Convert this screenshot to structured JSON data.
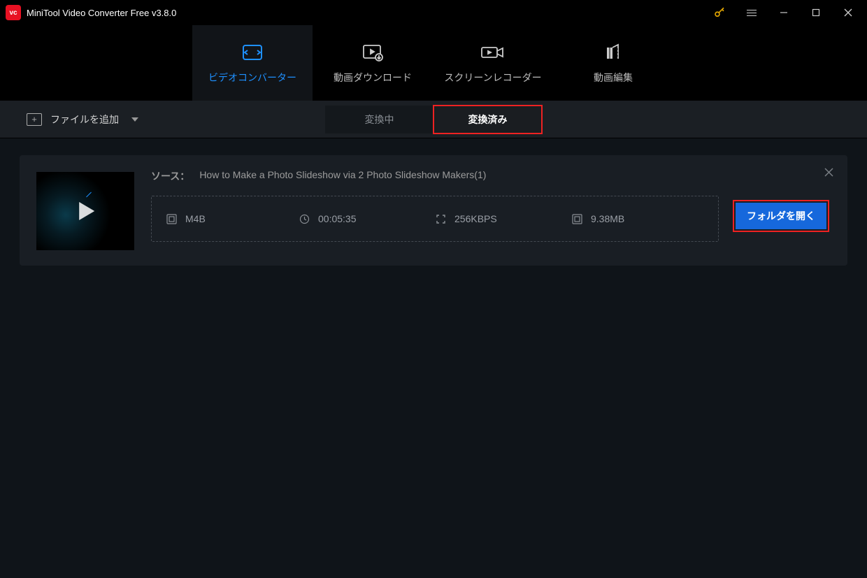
{
  "titlebar": {
    "app_name": "MiniTool Video Converter Free v3.8.0"
  },
  "nav": {
    "items": [
      {
        "label": "ビデオコンバーター"
      },
      {
        "label": "動画ダウンロード"
      },
      {
        "label": "スクリーンレコーダー"
      },
      {
        "label": "動画編集"
      }
    ]
  },
  "toolbar": {
    "add_file": "ファイルを追加",
    "status_tabs": {
      "converting": "変換中",
      "completed": "変換済み"
    }
  },
  "card": {
    "source_label": "ソース：",
    "source_name": "How to Make a Photo Slideshow via 2 Photo Slideshow Makers(1)",
    "format": "M4B",
    "duration": "00:05:35",
    "bitrate": "256KBPS",
    "size": "9.38MB",
    "open_folder": "フォルダを開く"
  }
}
